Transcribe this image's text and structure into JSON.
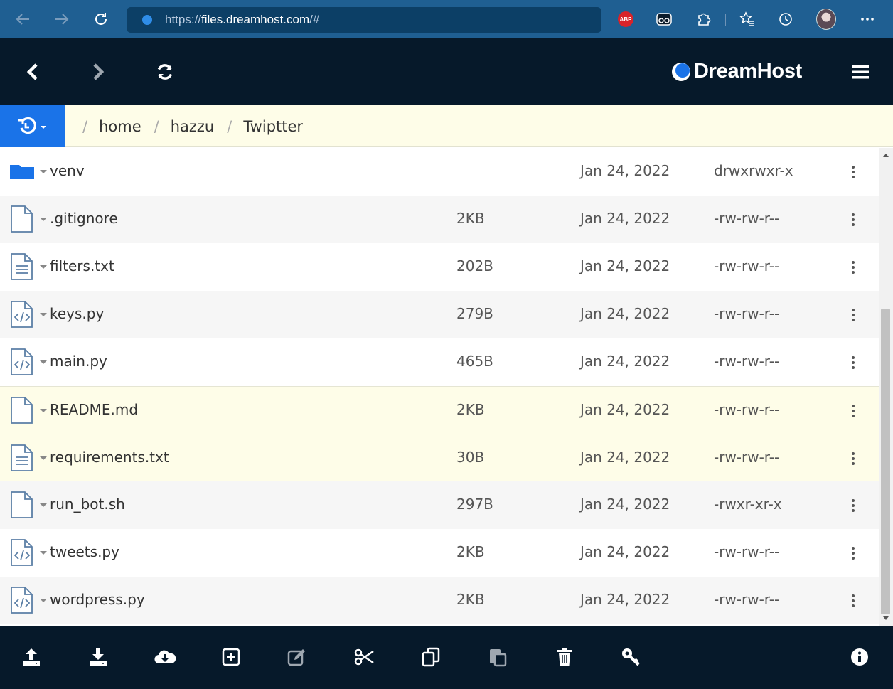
{
  "browser": {
    "url_prefix": "https://",
    "url_domain": "files.dreamhost.com",
    "url_suffix": "/#",
    "abp_label": "ABP"
  },
  "app": {
    "logo_text": "DreamHost",
    "brand_color": "#1a73e8",
    "header_bg": "#06192a"
  },
  "breadcrumb": {
    "items": [
      "home",
      "hazzu",
      "Twiptter"
    ]
  },
  "files": [
    {
      "icon": "folder-icon",
      "name": "venv",
      "size": "",
      "date": "Jan 24, 2022",
      "perm": "drwxrwxr-x"
    },
    {
      "icon": "file-icon",
      "name": ".gitignore",
      "size": "2KB",
      "date": "Jan 24, 2022",
      "perm": "-rw-rw-r--"
    },
    {
      "icon": "text-file-icon",
      "name": "filters.txt",
      "size": "202B",
      "date": "Jan 24, 2022",
      "perm": "-rw-rw-r--"
    },
    {
      "icon": "code-file-icon",
      "name": "keys.py",
      "size": "279B",
      "date": "Jan 24, 2022",
      "perm": "-rw-rw-r--"
    },
    {
      "icon": "code-file-icon",
      "name": "main.py",
      "size": "465B",
      "date": "Jan 24, 2022",
      "perm": "-rw-rw-r--"
    },
    {
      "icon": "file-icon",
      "name": "README.md",
      "size": "2KB",
      "date": "Jan 24, 2022",
      "perm": "-rw-rw-r--"
    },
    {
      "icon": "text-file-icon",
      "name": "requirements.txt",
      "size": "30B",
      "date": "Jan 24, 2022",
      "perm": "-rw-rw-r--"
    },
    {
      "icon": "file-icon",
      "name": "run_bot.sh",
      "size": "297B",
      "date": "Jan 24, 2022",
      "perm": "-rwxr-xr-x"
    },
    {
      "icon": "code-file-icon",
      "name": "tweets.py",
      "size": "2KB",
      "date": "Jan 24, 2022",
      "perm": "-rw-rw-r--"
    },
    {
      "icon": "code-file-icon",
      "name": "wordpress.py",
      "size": "2KB",
      "date": "Jan 24, 2022",
      "perm": "-rw-rw-r--"
    }
  ],
  "toolbar_icons": [
    "upload-icon",
    "download-icon",
    "cloud-download-icon",
    "new-file-icon",
    "edit-icon",
    "cut-icon",
    "copy-icon",
    "paste-icon",
    "delete-icon",
    "permissions-key-icon",
    "info-icon"
  ]
}
